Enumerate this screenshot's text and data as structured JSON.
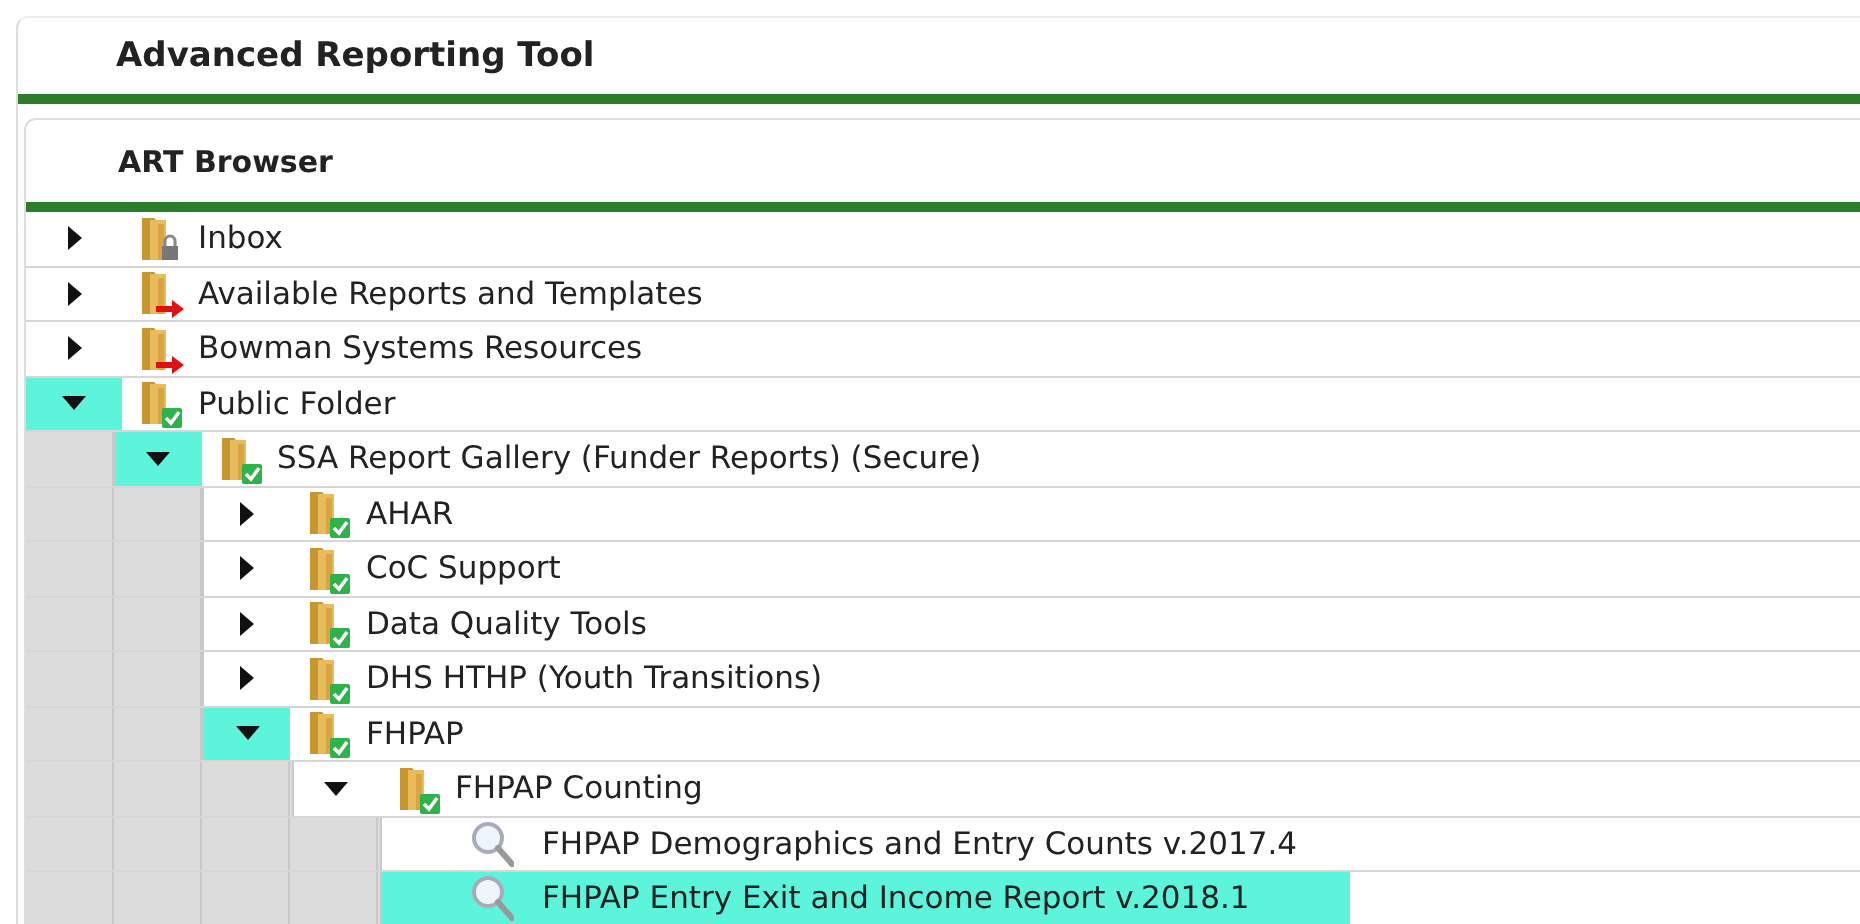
{
  "app_title": "Advanced Reporting Tool",
  "browser": {
    "title": "ART Browser",
    "tree": [
      {
        "kind": "locked",
        "label": "Inbox",
        "expanded": false,
        "highlighted": false
      },
      {
        "kind": "shared",
        "label": "Available Reports and Templates",
        "expanded": false,
        "highlighted": false
      },
      {
        "kind": "shared",
        "label": "Bowman Systems Resources",
        "expanded": false,
        "highlighted": false
      },
      {
        "kind": "approved",
        "label": "Public Folder",
        "expanded": true,
        "highlighted": true,
        "children": [
          {
            "kind": "approved",
            "label": "SSA Report Gallery (Funder Reports) (Secure)",
            "expanded": true,
            "highlighted": true,
            "children": [
              {
                "kind": "approved",
                "label": "AHAR",
                "expanded": false,
                "highlighted": false
              },
              {
                "kind": "approved",
                "label": "CoC Support",
                "expanded": false,
                "highlighted": false
              },
              {
                "kind": "approved",
                "label": "Data Quality Tools",
                "expanded": false,
                "highlighted": false
              },
              {
                "kind": "approved",
                "label": "DHS HTHP (Youth Transitions)",
                "expanded": false,
                "highlighted": false
              },
              {
                "kind": "approved",
                "label": "FHPAP",
                "expanded": true,
                "highlighted": true,
                "children": [
                  {
                    "kind": "approved",
                    "label": "FHPAP Counting",
                    "expanded": true,
                    "highlighted": false,
                    "children": [
                      {
                        "kind": "report",
                        "label": "FHPAP Demographics and Entry Counts v.2017.4",
                        "selected": false
                      },
                      {
                        "kind": "report",
                        "label": "FHPAP Entry Exit and Income Report v.2018.1",
                        "selected": true
                      }
                    ]
                  }
                ]
              }
            ]
          }
        ]
      }
    ]
  }
}
